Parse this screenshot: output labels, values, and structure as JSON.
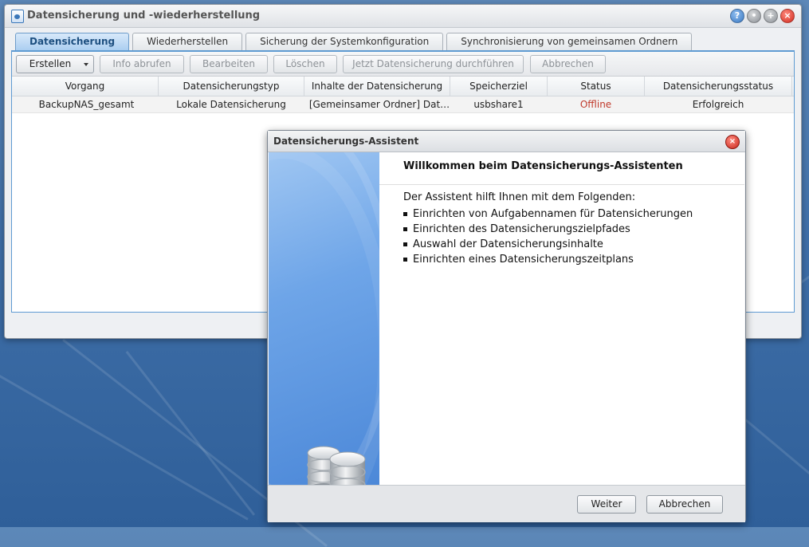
{
  "window": {
    "title": "Datensicherung und -wiederherstellung",
    "controls": {
      "help": "?",
      "min": "•",
      "max": "+",
      "close": "×"
    }
  },
  "tabs": [
    {
      "label": "Datensicherung",
      "active": true
    },
    {
      "label": "Wiederherstellen",
      "active": false
    },
    {
      "label": "Sicherung der Systemkonfiguration",
      "active": false
    },
    {
      "label": "Synchronisierung von gemeinsamen Ordnern",
      "active": false
    }
  ],
  "toolbar": {
    "create": "Erstellen",
    "info": "Info abrufen",
    "edit": "Bearbeiten",
    "delete": "Löschen",
    "backup_now": "Jetzt Datensicherung durchführen",
    "cancel": "Abbrechen"
  },
  "grid": {
    "headers": [
      "Vorgang",
      "Datensicherungstyp",
      "Inhalte der Datensicherung",
      "Speicherziel",
      "Status",
      "Datensicherungsstatus"
    ],
    "rows": [
      [
        "BackupNAS_gesamt",
        "Lokale Datensicherung",
        "[Gemeinsamer Ordner] Dat…",
        "usbshare1",
        "Offline",
        "Erfolgreich"
      ]
    ]
  },
  "dialog": {
    "title": "Datensicherungs-Assistent",
    "heading": "Willkommen beim Datensicherungs-Assistenten",
    "intro": "Der Assistent hilft Ihnen mit dem Folgenden:",
    "items": [
      "Einrichten von Aufgabennamen für Datensicherungen",
      "Einrichten des Datensicherungszielpfades",
      "Auswahl der Datensicherungsinhalte",
      "Einrichten eines Datensicherungszeitplans"
    ],
    "next": "Weiter",
    "cancel": "Abbrechen"
  },
  "colors": {
    "accent": "#5f9bd2",
    "offline": "#c0392b",
    "close": "#d0281b"
  },
  "icons": [
    "app-backup-icon",
    "help-icon",
    "minimize-icon",
    "maximize-icon",
    "close-icon",
    "database-icon"
  ]
}
